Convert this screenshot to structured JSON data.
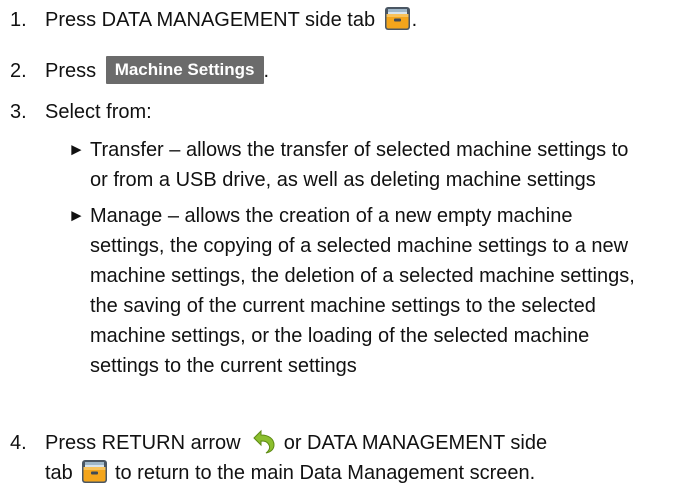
{
  "steps": [
    {
      "number": "1.",
      "before": "Press DATA MANAGEMENT side tab",
      "icon": "folder-icon",
      "after": "."
    },
    {
      "number": "2.",
      "before": "Press",
      "button_label": "Machine Settings",
      "after": "."
    },
    {
      "number": "3.",
      "text": "Select from:"
    },
    {
      "number": "4.",
      "before": "Press RETURN arrow",
      "icon_return": "return-arrow-icon",
      "middle": "or DATA MANAGEMENT side",
      "line2_before": "tab",
      "icon_folder": "folder-icon",
      "line2_after": "to return to the main Data Management screen."
    }
  ],
  "bullet_glyph": "►",
  "bullets": [
    {
      "lines": [
        "Transfer – allows the transfer of selected machine settings to",
        "or from a USB drive, as well as deleting machine settings"
      ]
    },
    {
      "lines": [
        "Manage – allows the creation of a new empty machine",
        "settings, the copying of a selected machine settings to a new",
        "machine settings, the deletion of a selected machine settings,",
        "the saving of the current machine settings to the selected",
        "machine settings, or the loading of the selected machine",
        "settings to the current settings"
      ]
    }
  ],
  "colors": {
    "folder_body": "#f3a51c",
    "folder_tab": "#3f4a56",
    "button_bg": "#6b6b6b",
    "return_arrow": "#8cbf2e"
  }
}
